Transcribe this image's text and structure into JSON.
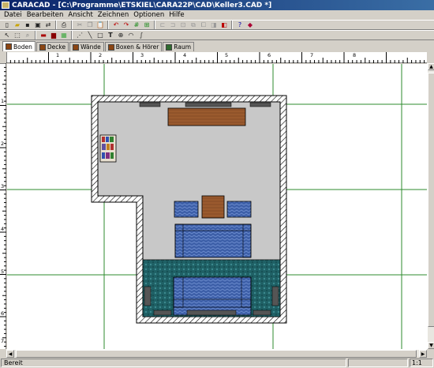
{
  "window": {
    "title": "CARACAD - [C:\\Programme\\ETSKIEL\\CARA22P\\CAD\\Keller3.CAD *]"
  },
  "menu": [
    "Datei",
    "Bearbeiten",
    "Ansicht",
    "Zeichnen",
    "Optionen",
    "Hilfe"
  ],
  "toolbar1_icons": [
    "new-icon",
    "open-icon",
    "save-icon",
    "save-as-icon",
    "import-icon",
    "print-icon",
    "cut-icon",
    "copy-icon",
    "paste-icon",
    "undo-icon",
    "redo-icon",
    "grid-icon",
    "snap-icon",
    "select-icon",
    "align-left-icon",
    "align-right-icon",
    "align-center-icon",
    "group-icon",
    "ungroup-icon",
    "front-icon",
    "back-icon",
    "help-icon",
    "eraser-icon"
  ],
  "toolbar2_icons": [
    "pointer-icon",
    "box-select-icon",
    "zoom-icon",
    "wall-icon",
    "room-icon",
    "furniture-icon",
    "draw-point-icon",
    "line-icon",
    "rect-icon",
    "text-icon",
    "circle-icon",
    "arc-icon",
    "curve-icon"
  ],
  "tabs": [
    {
      "label": "Boden",
      "active": true
    },
    {
      "label": "Decke",
      "active": false
    },
    {
      "label": "Wände",
      "active": false
    },
    {
      "label": "Boxen & Hörer",
      "active": false
    },
    {
      "label": "Raum",
      "active": false
    }
  ],
  "ruler": {
    "h_labels": [
      "1",
      "2",
      "3",
      "4",
      "5",
      "6",
      "7",
      "8"
    ],
    "v_labels": [
      "1",
      "2",
      "3",
      "4",
      "5",
      "6",
      "7"
    ]
  },
  "status": {
    "text": "Bereit",
    "zoom": "1:1"
  },
  "colors": {
    "room_floor": "#c8c8c8",
    "carpet": "#1f6065",
    "sofa": "#3d5fa8",
    "table": "#9a5a2e",
    "grid": "#2e8b2e",
    "wall_hatch": "#000000"
  }
}
